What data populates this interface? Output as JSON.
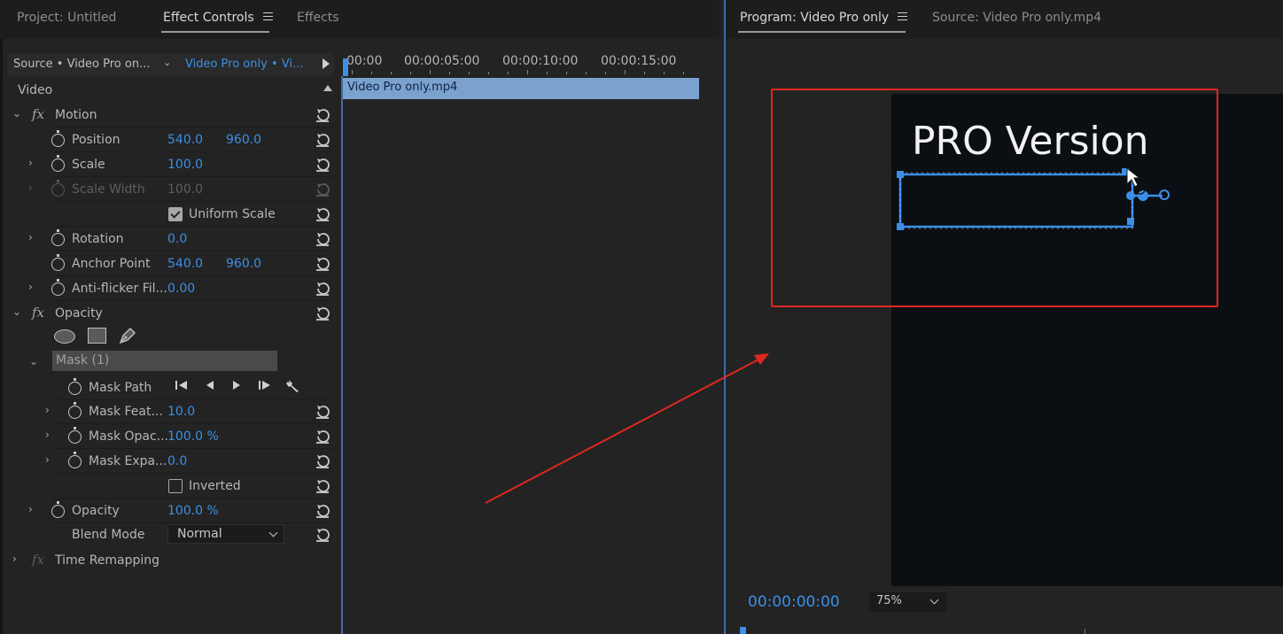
{
  "left_tabs": {
    "project": "Project: Untitled",
    "effect_controls": "Effect Controls",
    "effects": "Effects"
  },
  "right_tabs": {
    "program": "Program: Video Pro only",
    "source": "Source: Video Pro only.mp4"
  },
  "source_bar": {
    "source": "Source • Video Pro on...",
    "sequence": "Video Pro only • Vi..."
  },
  "timeline": {
    "ruler": [
      "00:00",
      "00:00:05:00",
      "00:00:10:00",
      "00:00:15:00"
    ],
    "clip_name": "Video Pro only.mp4"
  },
  "effects": {
    "video_label": "Video",
    "motion": "Motion",
    "position_label": "Position",
    "position_x": "540.0",
    "position_y": "960.0",
    "scale_label": "Scale",
    "scale_value": "100.0",
    "scale_width_label": "Scale Width",
    "scale_width_value": "100.0",
    "uniform_scale": "Uniform Scale",
    "uniform_scale_checked": true,
    "rotation_label": "Rotation",
    "rotation_value": "0.0",
    "anchor_label": "Anchor Point",
    "anchor_x": "540.0",
    "anchor_y": "960.0",
    "antiflicker_label": "Anti-flicker Fil...",
    "antiflicker_value": "0.00",
    "opacity_section": "Opacity",
    "mask_name": "Mask (1)",
    "mask_path": "Mask Path",
    "mask_feather_label": "Mask Feat...",
    "mask_feather_value": "10.0",
    "mask_opacity_label": "Mask Opac...",
    "mask_opacity_value": "100.0 %",
    "mask_expansion_label": "Mask Expa...",
    "mask_expansion_value": "0.0",
    "inverted_label": "Inverted",
    "inverted_checked": false,
    "opacity_label": "Opacity",
    "opacity_value": "100.0 %",
    "blend_mode_label": "Blend Mode",
    "blend_mode_value": "Normal",
    "time_remapping": "Time Remapping"
  },
  "monitor": {
    "overlay_text": "PRO Version",
    "timecode": "00:00:00:00",
    "zoom": "75%"
  },
  "colors": {
    "accent_blue": "#3b8fe8",
    "annotation_red": "#e0271f"
  }
}
